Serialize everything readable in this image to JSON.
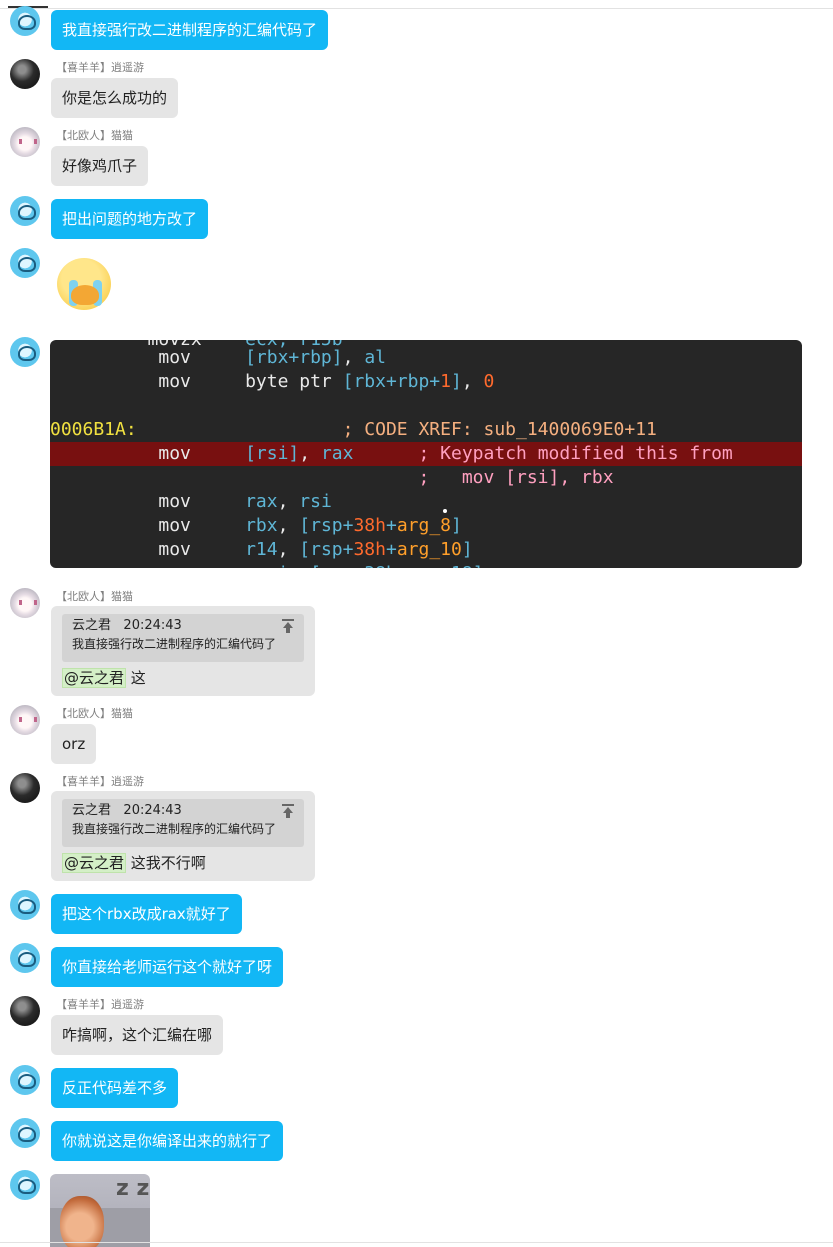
{
  "messages": {
    "m1": "我直接强行改二进制程序的汇编代码了",
    "m2_name": "【喜羊羊】逍遥游",
    "m2": "你是怎么成功的",
    "m3_name": "【北欧人】猫猫",
    "m3": "好像鸡爪子",
    "m4": "把出问题的地方改了",
    "m7_name": "【北欧人】猫猫",
    "m8_name": "【北欧人】猫猫",
    "m8": "orz",
    "m9_name": "【喜羊羊】逍遥游",
    "m10": "把这个rbx改成rax就好了",
    "m11": "你直接给老师运行这个就好了呀",
    "m12_name": "【喜羊羊】逍遥游",
    "m12": "咋搞啊，这个汇编在哪",
    "m13": "反正代码差不多",
    "m14": "你就说这是你编译出来的就行了"
  },
  "quotes": {
    "q1": {
      "author": "云之君",
      "time": "20:24:43",
      "text": "我直接强行改二进制程序的汇编代码了",
      "mention": "@云之君",
      "reply": "这"
    },
    "q2": {
      "author": "云之君",
      "time": "20:24:43",
      "text": "我直接强行改二进制程序的汇编代码了",
      "mention": "@云之君",
      "reply": "这我不行啊"
    }
  },
  "code": {
    "l1_op": "mov",
    "l2_op": "mov",
    "l3_label": "0006B1A:",
    "l3_comment": "; CODE XREF: sub_1400069E0+11",
    "l4_op": "mov",
    "l4_comment": "; Keypatch modified this from",
    "l5_comment": ";   mov [rsi], rbx",
    "l6_op": "mov",
    "l7_op": "mov",
    "l8_op": "mov"
  },
  "icons": {
    "self_avatar": "blue-cartoon-avatar-icon",
    "goat_avatar": "dark-avatar-icon",
    "cat_avatar": "anime-cat-avatar-icon",
    "sticker": "crying-emoji-sticker",
    "photo": "sleeping-boy-meme-image",
    "quote_jump": "jump-to-top-icon"
  },
  "colors": {
    "self_bubble": "#12b7f5",
    "other_bubble": "#e5e5e5",
    "code_bg": "#262626",
    "code_highlight": "#781010"
  }
}
